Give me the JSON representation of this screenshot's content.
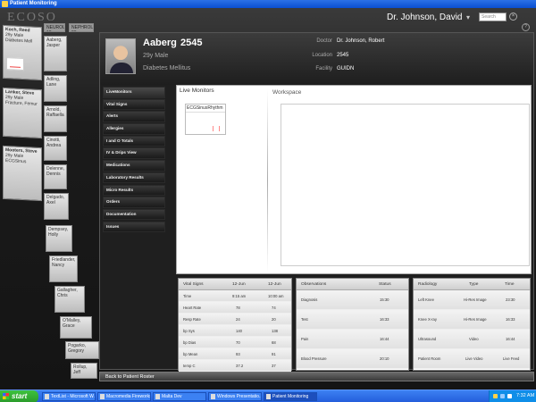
{
  "window": {
    "title": "Patient Monitoring"
  },
  "app": {
    "brand": "ECOSO",
    "user": "Dr. Johnson, David",
    "user_menu_icon": "chevron-down-icon",
    "search_placeholder": "Search"
  },
  "patient_stack": [
    {
      "name": "Koch, Reed",
      "age": "29y Male",
      "meta": "Diabetes Mell"
    },
    {
      "name": "Lanker, Steve",
      "age": "29y Male",
      "meta": "Fracture, Femur"
    },
    {
      "name": "Mooters, Steve",
      "age": "29y Male",
      "meta": "ECGSinus"
    }
  ],
  "stack_names": [
    "Aaberg, Jasper",
    "Adling, Lane",
    "Arnold, Raffaella",
    "Cinotti, Andrea",
    "Delenne, Dennis",
    "Delgado, Axel",
    "Dempsey, Holly",
    "Friedlander, Nancy",
    "Gallagher, Chris",
    "O'Malley, Grace",
    "Pogarko, Gregory",
    "Rollup, Jeff"
  ],
  "stack_headers": [
    "NEUROLOGY 18",
    "NEPHROLOGY 28"
  ],
  "patient": {
    "last_name": "Aaberg",
    "id": "2545",
    "demographics": "29y Male",
    "diagnosis": "Diabetes Mellitus",
    "fields": [
      {
        "label": "Doctor",
        "value": "Dr. Johnson, Robert"
      },
      {
        "label": "Location",
        "value": "2545"
      },
      {
        "label": "Facility",
        "value": "GUIDN"
      }
    ]
  },
  "nav": [
    "LiveMonitors",
    "Vital Signs",
    "Alerts",
    "Allergies",
    "I and O Totals",
    "IV & Drips View",
    "Medications",
    "Laboratory Results",
    "Micro Results",
    "Orders",
    "Documentation",
    "Issues"
  ],
  "live_monitors": {
    "title": "Live Monitors",
    "monitor": "ECGSinusRhythm"
  },
  "workspace": {
    "title": "Workspace"
  },
  "vitals": {
    "headers": [
      "Vital Signs",
      "12-Jun",
      "12-Jun"
    ],
    "rows": [
      [
        "Time",
        "9:15 am",
        "10:00 am"
      ],
      [
        "Heart Rate",
        "78",
        "74"
      ],
      [
        "Resp Rate",
        "24",
        "20"
      ],
      [
        "bp Sys",
        "140",
        "138"
      ],
      [
        "bp Dias",
        "70",
        "68"
      ],
      [
        "bp Mean",
        "93",
        "91"
      ],
      [
        "temp C",
        "37.2",
        "37"
      ]
    ]
  },
  "observations": {
    "headers": [
      "Observations",
      "Status"
    ],
    "rows": [
      [
        "Diagnosis",
        "15:30"
      ],
      [
        "Test",
        "16:33"
      ],
      [
        "Pain",
        "16:44"
      ],
      [
        "Blood Pressure",
        "20:10"
      ]
    ]
  },
  "radiology": {
    "headers": [
      "Radiology",
      "Type",
      "Time"
    ],
    "rows": [
      [
        "Left Knee",
        "Hi-Res Image",
        "23:30"
      ],
      [
        "Knee X-ray",
        "Hi-Res Image",
        "16:33"
      ],
      [
        "Ultrasound",
        "Video",
        "16:44"
      ],
      [
        "Patient Room",
        "Live Video",
        "Live Feed"
      ]
    ]
  },
  "back_button": "Back to Patient Roster",
  "taskbar": {
    "start": "start",
    "items": [
      "TextList - Microsoft W...",
      "Macromedia Fireworks...",
      "Malta Dev",
      "Windows Presentatio...",
      "Patient Monitoring"
    ],
    "clock": "7:32 AM"
  }
}
